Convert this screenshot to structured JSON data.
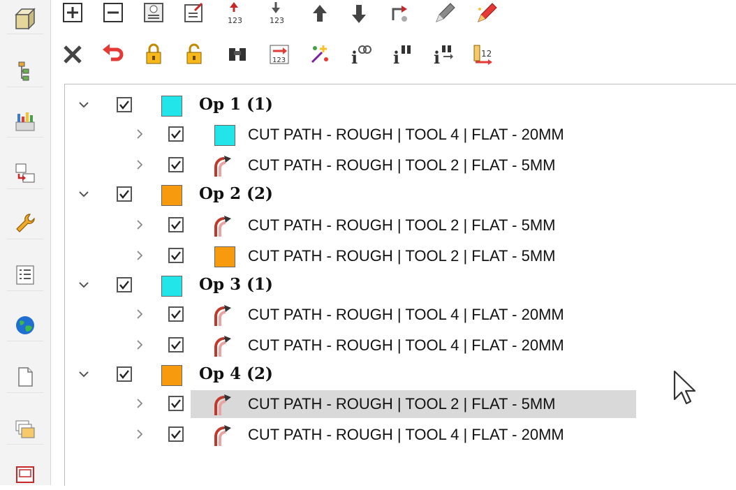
{
  "toolbar": {
    "row1": [
      "expand-all-icon",
      "collapse-all-icon",
      "report-icon",
      "export-icon",
      "renumber-up-icon",
      "renumber-down-icon",
      "arrow-up-icon",
      "arrow-down-icon",
      "transform-icon",
      "pencil-icon",
      "magic-pencil-icon"
    ],
    "row2": [
      "delete-icon",
      "undo-icon",
      "lock-icon",
      "unlock-icon",
      "find-icon",
      "sequence-icon",
      "sparkle-icon",
      "info-link-icon",
      "info-find-icon",
      "info-binoculars-icon",
      "number-sort-icon"
    ]
  },
  "left_strip": [
    "3d-box-icon",
    "tree-structure-icon",
    "toolpath-chart-icon",
    "transfer-icon",
    "wrench-icon",
    "list-icon",
    "globe-icon",
    "document-icon",
    "layers-icon",
    "frame-icon"
  ],
  "colors": {
    "cyan": "#22e5ea",
    "orange": "#f79a0d",
    "highlight": "#d9d9d9"
  },
  "tree": {
    "groups": [
      {
        "label": "Op 1 (1)",
        "swatch": "cyan",
        "children": [
          {
            "icon": "swatch-cyan",
            "label": "CUT PATH - ROUGH | TOOL 4 | FLAT - 20MM"
          },
          {
            "icon": "toolpath-icon",
            "label": "CUT PATH - ROUGH | TOOL 2 | FLAT - 5MM"
          }
        ]
      },
      {
        "label": "Op 2 (2)",
        "swatch": "orange",
        "children": [
          {
            "icon": "toolpath-icon",
            "label": "CUT PATH - ROUGH | TOOL 2 | FLAT - 5MM"
          },
          {
            "icon": "swatch-orange",
            "label": "CUT PATH - ROUGH | TOOL 2 | FLAT - 5MM"
          }
        ]
      },
      {
        "label": "Op 3 (1)",
        "swatch": "cyan",
        "children": [
          {
            "icon": "toolpath-icon",
            "label": "CUT PATH - ROUGH | TOOL 4 | FLAT - 20MM"
          },
          {
            "icon": "toolpath-icon",
            "label": "CUT PATH - ROUGH | TOOL 4 | FLAT - 20MM"
          }
        ]
      },
      {
        "label": "Op 4 (2)",
        "swatch": "orange",
        "children": [
          {
            "icon": "toolpath-icon",
            "label": "CUT PATH - ROUGH | TOOL 2 | FLAT - 5MM",
            "selected": true
          },
          {
            "icon": "toolpath-icon",
            "label": "CUT PATH - ROUGH | TOOL 4 | FLAT - 20MM"
          }
        ]
      }
    ]
  }
}
